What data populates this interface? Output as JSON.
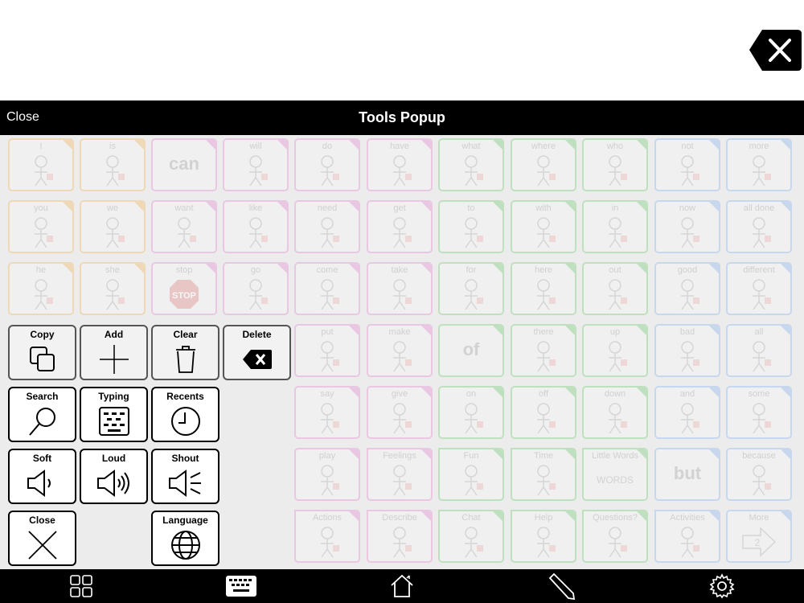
{
  "header": {
    "close_label": "Close",
    "title": "Tools Popup"
  },
  "tools": [
    {
      "label": "Copy",
      "icon": "copy-icon"
    },
    {
      "label": "Add",
      "icon": "plus-icon"
    },
    {
      "label": "Clear",
      "icon": "trash-icon"
    },
    {
      "label": "Delete",
      "icon": "backspace-icon"
    },
    {
      "label": "Search",
      "icon": "magnifier-icon"
    },
    {
      "label": "Typing",
      "icon": "keyboard-icon"
    },
    {
      "label": "Recents",
      "icon": "clock-icon"
    },
    {
      "label": "Soft",
      "icon": "speaker-low-icon"
    },
    {
      "label": "Loud",
      "icon": "speaker-loud-icon"
    },
    {
      "label": "Shout",
      "icon": "speaker-shout-icon"
    },
    {
      "label": "Close",
      "icon": "close-icon"
    },
    {
      "label": "Language",
      "icon": "globe-icon"
    }
  ],
  "grid": {
    "rows": [
      [
        "I",
        "is",
        "can",
        "will",
        "do",
        "have",
        "what",
        "where",
        "who",
        "not",
        "more"
      ],
      [
        "you",
        "we",
        "want",
        "like",
        "need",
        "get",
        "to",
        "with",
        "in",
        "now",
        "all done"
      ],
      [
        "he",
        "she",
        "stop",
        "go",
        "come",
        "take",
        "for",
        "here",
        "out",
        "good",
        "different"
      ],
      [
        "",
        "",
        "",
        "",
        "put",
        "make",
        "of",
        "there",
        "up",
        "bad",
        "all"
      ],
      [
        "",
        "",
        "",
        "",
        "say",
        "give",
        "on",
        "off",
        "down",
        "and",
        "some"
      ],
      [
        "",
        "",
        "",
        "",
        "play",
        "Feelings",
        "Fun",
        "Time",
        "Little Words",
        "but",
        "because"
      ],
      [
        "",
        "",
        "",
        "",
        "Actions",
        "Describe",
        "Chat",
        "Help",
        "Questions?",
        "Activities",
        "More"
      ]
    ],
    "bigwords": {
      "can": "can",
      "of": "of",
      "but": "but"
    },
    "little_words_text": "WORDS",
    "stop_sign_text": "STOP",
    "more_number": "2"
  },
  "colors": {
    "pronoun": "#f2c88a",
    "verb": "#e7a9dc",
    "question": "#9cd89c",
    "negation": "#a9c6ee",
    "noun": "#f2e69a"
  },
  "bottom_bar": [
    {
      "name": "grid-icon"
    },
    {
      "name": "keyboard-icon"
    },
    {
      "name": "home-icon"
    },
    {
      "name": "pencil-icon"
    },
    {
      "name": "settings-gear-icon"
    }
  ]
}
